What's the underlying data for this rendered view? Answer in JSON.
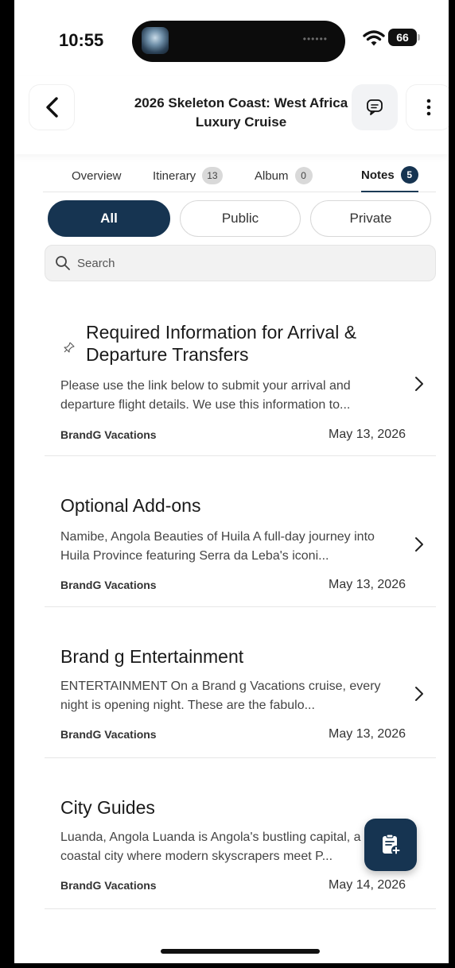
{
  "status_bar": {
    "time": "10:55",
    "battery": "66",
    "island_dots": "••••••"
  },
  "header": {
    "title": "2026 Skeleton Coast: West Africa Luxury Cruise"
  },
  "tabs": [
    {
      "label": "Overview",
      "count": ""
    },
    {
      "label": "Itinerary",
      "count": "13"
    },
    {
      "label": "Album",
      "count": "0"
    },
    {
      "label": "Notes",
      "count": "5",
      "active": true
    }
  ],
  "filters": [
    {
      "label": "All",
      "active": true
    },
    {
      "label": "Public"
    },
    {
      "label": "Private"
    }
  ],
  "search": {
    "placeholder": "Search"
  },
  "notes": [
    {
      "title": "Required Information for Arrival & Departure Transfers",
      "pinned": true,
      "body": "Please use the link below to submit your arrival and departure flight details. We use this information to...",
      "author": "BrandG Vacations",
      "date": "May 13, 2026"
    },
    {
      "title": "Optional Add-ons",
      "body": "Namibe, Angola Beauties of Huila A full-day journey into Huila Province featuring Serra da Leba's iconi...",
      "author": "BrandG Vacations",
      "date": "May 13, 2026"
    },
    {
      "title": "Brand g Entertainment",
      "body": "ENTERTAINMENT On a Brand g Vacations cruise, every night is opening night. These are the fabulo...",
      "author": "BrandG Vacations",
      "date": "May 13, 2026"
    },
    {
      "title": "City Guides",
      "body": "Luanda, Angola Luanda is Angola's bustling capital, a coastal city where modern skyscrapers meet P...",
      "author": "BrandG Vacations",
      "date": "May 14, 2026"
    }
  ],
  "colors": {
    "accent": "#163451",
    "divider": "#e6e6e6"
  }
}
